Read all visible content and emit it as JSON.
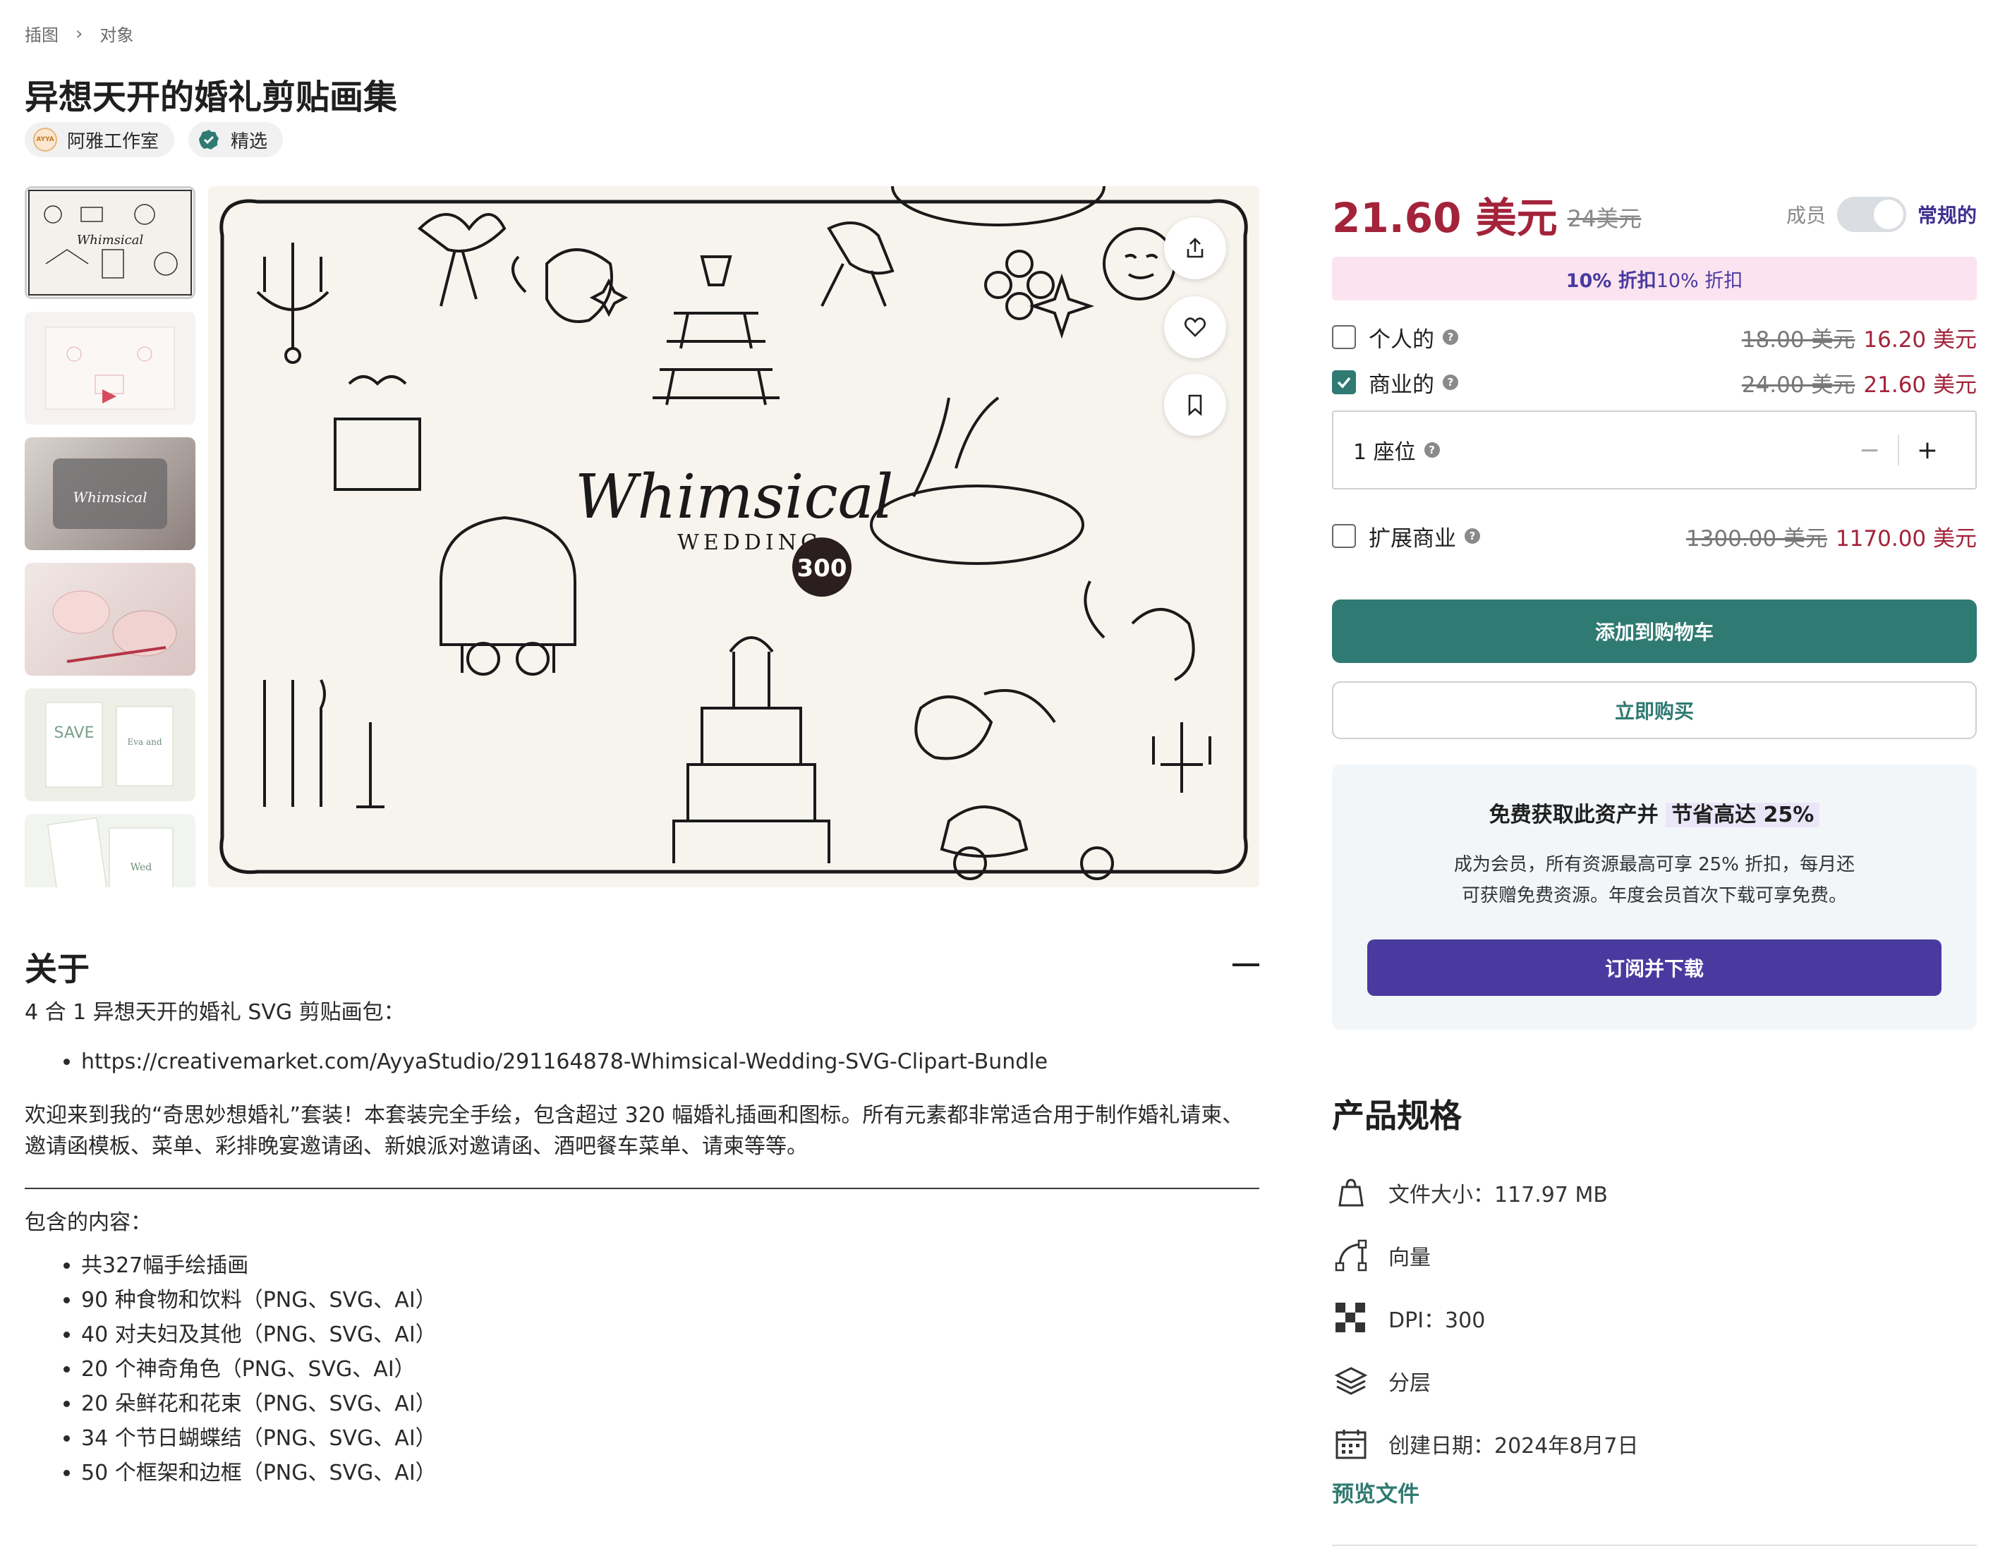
{
  "breadcrumb": {
    "items": [
      "插图",
      "对象"
    ],
    "sep": "›"
  },
  "product": {
    "title": "异想天开的婚礼剪贴画集",
    "shop_name": "阿雅工作室",
    "shop_logo_text": "AYYA",
    "featured_label": "精选",
    "image_caption": "Whimsical",
    "image_sub": "WEDDING",
    "image_badge": "300"
  },
  "about": {
    "title": "关于",
    "intro": "4 合 1 异想天开的婚礼 SVG 剪贴画包：",
    "links": [
      "https://creativemarket.com/AyyaStudio/291164878-Whimsical-Wedding-SVG-Clipart-Bundle"
    ],
    "description": "欢迎来到我的“奇思妙想婚礼”套装！本套装完全手绘，包含超过 320 幅婚礼插画和图标。所有元素都非常适合用于制作婚礼请柬、邀请函模板、菜单、彩排晚宴邀请函、新娘派对邀请函、酒吧餐车菜单、请柬等等。",
    "contents_label": "包含的内容：",
    "contents": [
      "共327幅手绘插画",
      "90 种食物和饮料（PNG、SVG、AI）",
      "40 对夫妇及其他（PNG、SVG、AI）",
      "20 个神奇角色（PNG、SVG、AI）",
      "20 朵鲜花和花束（PNG、SVG、AI）",
      "34 个节日蝴蝶结（PNG、SVG、AI）",
      "50 个框架和边框（PNG、SVG、AI）"
    ]
  },
  "pricing": {
    "price": "21.60 美元",
    "old_price": "24美元",
    "member_label": "成员",
    "regular_label": "常规的",
    "discount_text": "10% 折扣",
    "discount_text2": "10% 折扣",
    "licenses": [
      {
        "name": "个人的",
        "old": "18.00 美元",
        "new": "16.20 美元",
        "checked": false
      },
      {
        "name": "商业的",
        "old": "24.00 美元",
        "new": "21.60 美元",
        "checked": true
      },
      {
        "name": "扩展商业",
        "old": "1300.00 美元",
        "new": "1170.00 美元",
        "checked": false
      }
    ],
    "seats_label": "1 座位",
    "minus": "−",
    "plus": "+",
    "add_to_cart": "添加到购物车",
    "buy_now": "立即购买"
  },
  "promo": {
    "title_prefix": "免费获取此资产并 ",
    "title_highlight": "节省高达 25%",
    "text_line1": "成为会员，所有资源最高可享 25% 折扣，每月还",
    "text_line2": "可获赠免费资源。年度会员首次下载可享免费。",
    "button": "订阅并下载"
  },
  "specs": {
    "title": "产品规格",
    "items": [
      {
        "icon": "bag-icon",
        "text": "文件大小：117.97 MB"
      },
      {
        "icon": "vector-icon",
        "text": "向量"
      },
      {
        "icon": "dpi-icon",
        "text": "DPI：300"
      },
      {
        "icon": "layers-icon",
        "text": "分层"
      },
      {
        "icon": "calendar-icon",
        "text": "创建日期：2024年8月7日"
      }
    ],
    "preview": "预览文件"
  },
  "colors": {
    "accent": "#2f7a72",
    "price": "#a3233a",
    "purple": "#4a3aa0"
  }
}
